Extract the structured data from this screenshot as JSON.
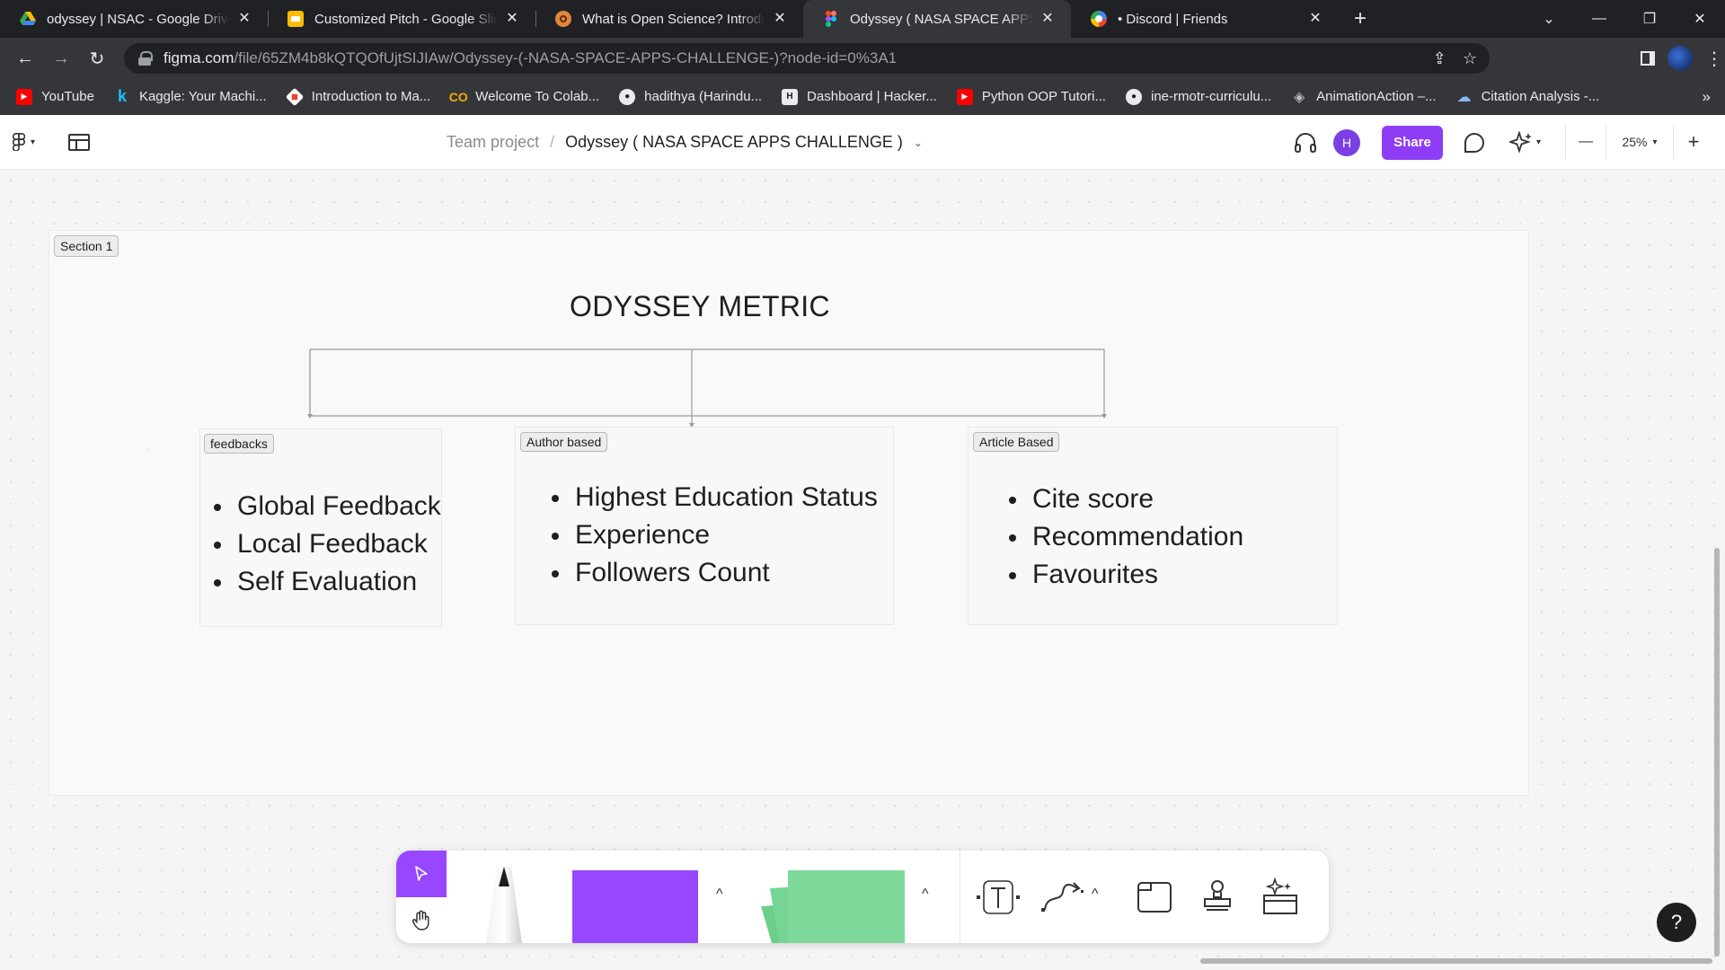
{
  "browser": {
    "tabs": [
      {
        "title": "odyssey | NSAC - Google Drive",
        "icon": "google-drive-icon",
        "active": false
      },
      {
        "title": "Customized Pitch - Google Slides",
        "icon": "google-slides-icon",
        "active": false
      },
      {
        "title": "What is Open Science? Introduction",
        "icon": "open-science-icon",
        "active": false
      },
      {
        "title": "Odyssey ( NASA SPACE APPS CHALLENGE )",
        "icon": "figma-icon",
        "active": true
      },
      {
        "title": "• Discord | Friends",
        "icon": "discord-icon",
        "active": false
      }
    ],
    "close_glyph": "✕",
    "new_tab_glyph": "+",
    "url_host": "figma.com",
    "url_path": "/file/65ZM4b8kQTQOfUjtSIJIAw/Odyssey-(-NASA-SPACE-APPS-CHALLENGE-)?node-id=0%3A1",
    "bookmarks": [
      {
        "label": "YouTube",
        "icon": "youtube-icon",
        "color": "#ff0000"
      },
      {
        "label": "Kaggle: Your Machi...",
        "icon": "kaggle-icon",
        "color": "#20beff"
      },
      {
        "label": "Introduction to Ma...",
        "icon": "colab-diamond-icon",
        "color": "#e8eaed"
      },
      {
        "label": "Welcome To Colab...",
        "icon": "colab-icon",
        "color": "#f9ab00"
      },
      {
        "label": "hadithya (Harindu...",
        "icon": "github-icon",
        "color": "#e8eaed"
      },
      {
        "label": "Dashboard | Hacker...",
        "icon": "hackerrank-icon",
        "color": "#e8eaed"
      },
      {
        "label": "Python OOP Tutori...",
        "icon": "youtube-icon",
        "color": "#ff0000"
      },
      {
        "label": "ine-rmotr-curriculu...",
        "icon": "github-icon",
        "color": "#e8eaed"
      },
      {
        "label": "AnimationAction –...",
        "icon": "unity-icon",
        "color": "#bdbdbd"
      },
      {
        "label": "Citation Analysis -...",
        "icon": "cloud-icon",
        "color": "#8ab4f8"
      }
    ],
    "bookmarks_more": "»"
  },
  "figma": {
    "breadcrumb_team": "Team project",
    "breadcrumb_sep": "/",
    "file_name": "Odyssey ( NASA SPACE APPS CHALLENGE )",
    "avatar_initial": "H",
    "share_label": "Share",
    "zoom_level": "25%",
    "zoom_out": "—",
    "zoom_in": "+",
    "accent": "#9747ff",
    "share_color": "#8f3cf7"
  },
  "canvas": {
    "section_label": "Section 1",
    "title": "ODYSSEY METRIC",
    "cards": [
      {
        "label": "feedbacks",
        "items": [
          "Global Feedback",
          "Local Feedback",
          "Self Evaluation"
        ]
      },
      {
        "label": "Author based",
        "items": [
          "Highest Education Status",
          "Experience",
          "Followers Count"
        ]
      },
      {
        "label": "Article Based",
        "items": [
          "Cite score",
          "Recommendation",
          "Favourites"
        ]
      }
    ]
  },
  "dock": {
    "sticky_color": "#7ed99a",
    "shape_color": "#9747ff"
  },
  "help_label": "?"
}
